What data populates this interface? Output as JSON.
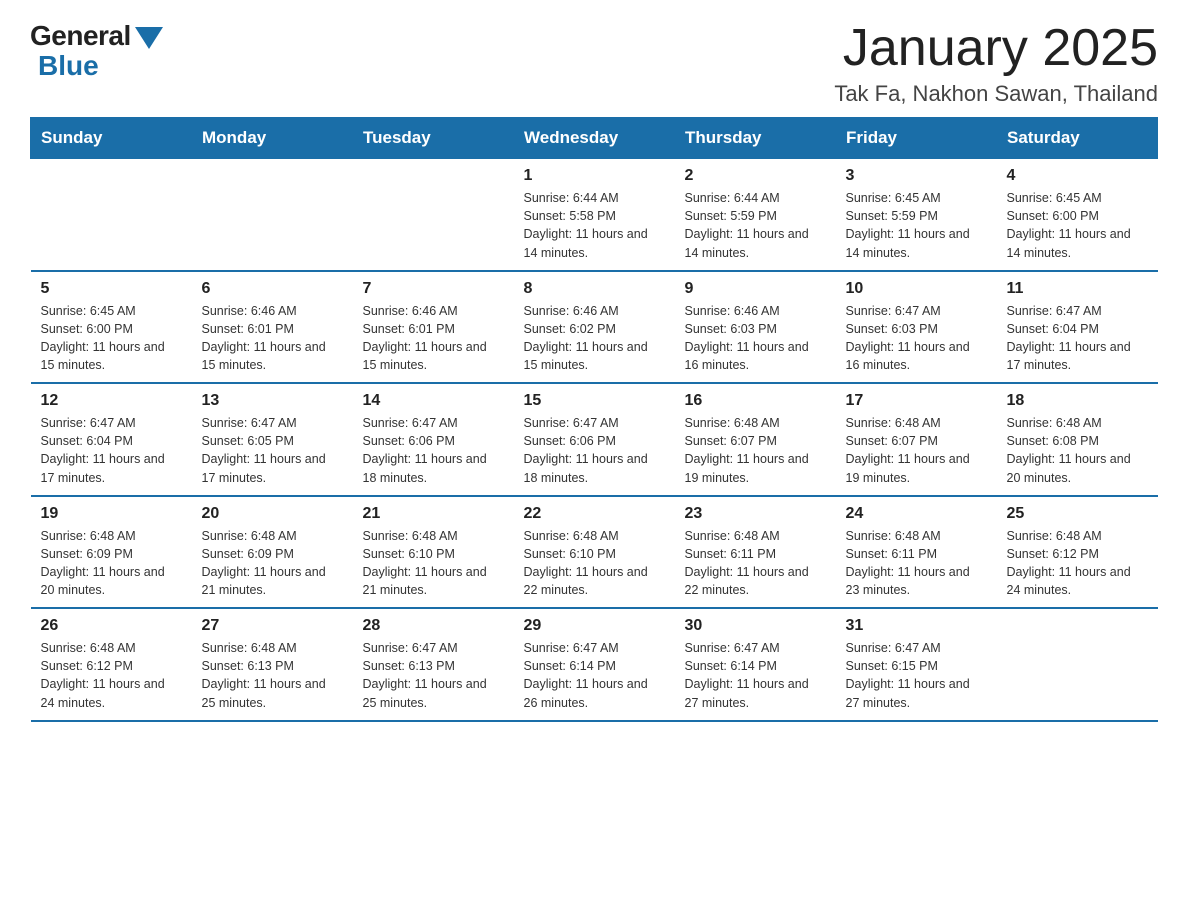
{
  "logo": {
    "general": "General",
    "blue": "Blue"
  },
  "header": {
    "title": "January 2025",
    "subtitle": "Tak Fa, Nakhon Sawan, Thailand"
  },
  "weekdays": [
    "Sunday",
    "Monday",
    "Tuesday",
    "Wednesday",
    "Thursday",
    "Friday",
    "Saturday"
  ],
  "weeks": [
    [
      {
        "day": "",
        "sunrise": "",
        "sunset": "",
        "daylight": ""
      },
      {
        "day": "",
        "sunrise": "",
        "sunset": "",
        "daylight": ""
      },
      {
        "day": "",
        "sunrise": "",
        "sunset": "",
        "daylight": ""
      },
      {
        "day": "1",
        "sunrise": "Sunrise: 6:44 AM",
        "sunset": "Sunset: 5:58 PM",
        "daylight": "Daylight: 11 hours and 14 minutes."
      },
      {
        "day": "2",
        "sunrise": "Sunrise: 6:44 AM",
        "sunset": "Sunset: 5:59 PM",
        "daylight": "Daylight: 11 hours and 14 minutes."
      },
      {
        "day": "3",
        "sunrise": "Sunrise: 6:45 AM",
        "sunset": "Sunset: 5:59 PM",
        "daylight": "Daylight: 11 hours and 14 minutes."
      },
      {
        "day": "4",
        "sunrise": "Sunrise: 6:45 AM",
        "sunset": "Sunset: 6:00 PM",
        "daylight": "Daylight: 11 hours and 14 minutes."
      }
    ],
    [
      {
        "day": "5",
        "sunrise": "Sunrise: 6:45 AM",
        "sunset": "Sunset: 6:00 PM",
        "daylight": "Daylight: 11 hours and 15 minutes."
      },
      {
        "day": "6",
        "sunrise": "Sunrise: 6:46 AM",
        "sunset": "Sunset: 6:01 PM",
        "daylight": "Daylight: 11 hours and 15 minutes."
      },
      {
        "day": "7",
        "sunrise": "Sunrise: 6:46 AM",
        "sunset": "Sunset: 6:01 PM",
        "daylight": "Daylight: 11 hours and 15 minutes."
      },
      {
        "day": "8",
        "sunrise": "Sunrise: 6:46 AM",
        "sunset": "Sunset: 6:02 PM",
        "daylight": "Daylight: 11 hours and 15 minutes."
      },
      {
        "day": "9",
        "sunrise": "Sunrise: 6:46 AM",
        "sunset": "Sunset: 6:03 PM",
        "daylight": "Daylight: 11 hours and 16 minutes."
      },
      {
        "day": "10",
        "sunrise": "Sunrise: 6:47 AM",
        "sunset": "Sunset: 6:03 PM",
        "daylight": "Daylight: 11 hours and 16 minutes."
      },
      {
        "day": "11",
        "sunrise": "Sunrise: 6:47 AM",
        "sunset": "Sunset: 6:04 PM",
        "daylight": "Daylight: 11 hours and 17 minutes."
      }
    ],
    [
      {
        "day": "12",
        "sunrise": "Sunrise: 6:47 AM",
        "sunset": "Sunset: 6:04 PM",
        "daylight": "Daylight: 11 hours and 17 minutes."
      },
      {
        "day": "13",
        "sunrise": "Sunrise: 6:47 AM",
        "sunset": "Sunset: 6:05 PM",
        "daylight": "Daylight: 11 hours and 17 minutes."
      },
      {
        "day": "14",
        "sunrise": "Sunrise: 6:47 AM",
        "sunset": "Sunset: 6:06 PM",
        "daylight": "Daylight: 11 hours and 18 minutes."
      },
      {
        "day": "15",
        "sunrise": "Sunrise: 6:47 AM",
        "sunset": "Sunset: 6:06 PM",
        "daylight": "Daylight: 11 hours and 18 minutes."
      },
      {
        "day": "16",
        "sunrise": "Sunrise: 6:48 AM",
        "sunset": "Sunset: 6:07 PM",
        "daylight": "Daylight: 11 hours and 19 minutes."
      },
      {
        "day": "17",
        "sunrise": "Sunrise: 6:48 AM",
        "sunset": "Sunset: 6:07 PM",
        "daylight": "Daylight: 11 hours and 19 minutes."
      },
      {
        "day": "18",
        "sunrise": "Sunrise: 6:48 AM",
        "sunset": "Sunset: 6:08 PM",
        "daylight": "Daylight: 11 hours and 20 minutes."
      }
    ],
    [
      {
        "day": "19",
        "sunrise": "Sunrise: 6:48 AM",
        "sunset": "Sunset: 6:09 PM",
        "daylight": "Daylight: 11 hours and 20 minutes."
      },
      {
        "day": "20",
        "sunrise": "Sunrise: 6:48 AM",
        "sunset": "Sunset: 6:09 PM",
        "daylight": "Daylight: 11 hours and 21 minutes."
      },
      {
        "day": "21",
        "sunrise": "Sunrise: 6:48 AM",
        "sunset": "Sunset: 6:10 PM",
        "daylight": "Daylight: 11 hours and 21 minutes."
      },
      {
        "day": "22",
        "sunrise": "Sunrise: 6:48 AM",
        "sunset": "Sunset: 6:10 PM",
        "daylight": "Daylight: 11 hours and 22 minutes."
      },
      {
        "day": "23",
        "sunrise": "Sunrise: 6:48 AM",
        "sunset": "Sunset: 6:11 PM",
        "daylight": "Daylight: 11 hours and 22 minutes."
      },
      {
        "day": "24",
        "sunrise": "Sunrise: 6:48 AM",
        "sunset": "Sunset: 6:11 PM",
        "daylight": "Daylight: 11 hours and 23 minutes."
      },
      {
        "day": "25",
        "sunrise": "Sunrise: 6:48 AM",
        "sunset": "Sunset: 6:12 PM",
        "daylight": "Daylight: 11 hours and 24 minutes."
      }
    ],
    [
      {
        "day": "26",
        "sunrise": "Sunrise: 6:48 AM",
        "sunset": "Sunset: 6:12 PM",
        "daylight": "Daylight: 11 hours and 24 minutes."
      },
      {
        "day": "27",
        "sunrise": "Sunrise: 6:48 AM",
        "sunset": "Sunset: 6:13 PM",
        "daylight": "Daylight: 11 hours and 25 minutes."
      },
      {
        "day": "28",
        "sunrise": "Sunrise: 6:47 AM",
        "sunset": "Sunset: 6:13 PM",
        "daylight": "Daylight: 11 hours and 25 minutes."
      },
      {
        "day": "29",
        "sunrise": "Sunrise: 6:47 AM",
        "sunset": "Sunset: 6:14 PM",
        "daylight": "Daylight: 11 hours and 26 minutes."
      },
      {
        "day": "30",
        "sunrise": "Sunrise: 6:47 AM",
        "sunset": "Sunset: 6:14 PM",
        "daylight": "Daylight: 11 hours and 27 minutes."
      },
      {
        "day": "31",
        "sunrise": "Sunrise: 6:47 AM",
        "sunset": "Sunset: 6:15 PM",
        "daylight": "Daylight: 11 hours and 27 minutes."
      },
      {
        "day": "",
        "sunrise": "",
        "sunset": "",
        "daylight": ""
      }
    ]
  ]
}
